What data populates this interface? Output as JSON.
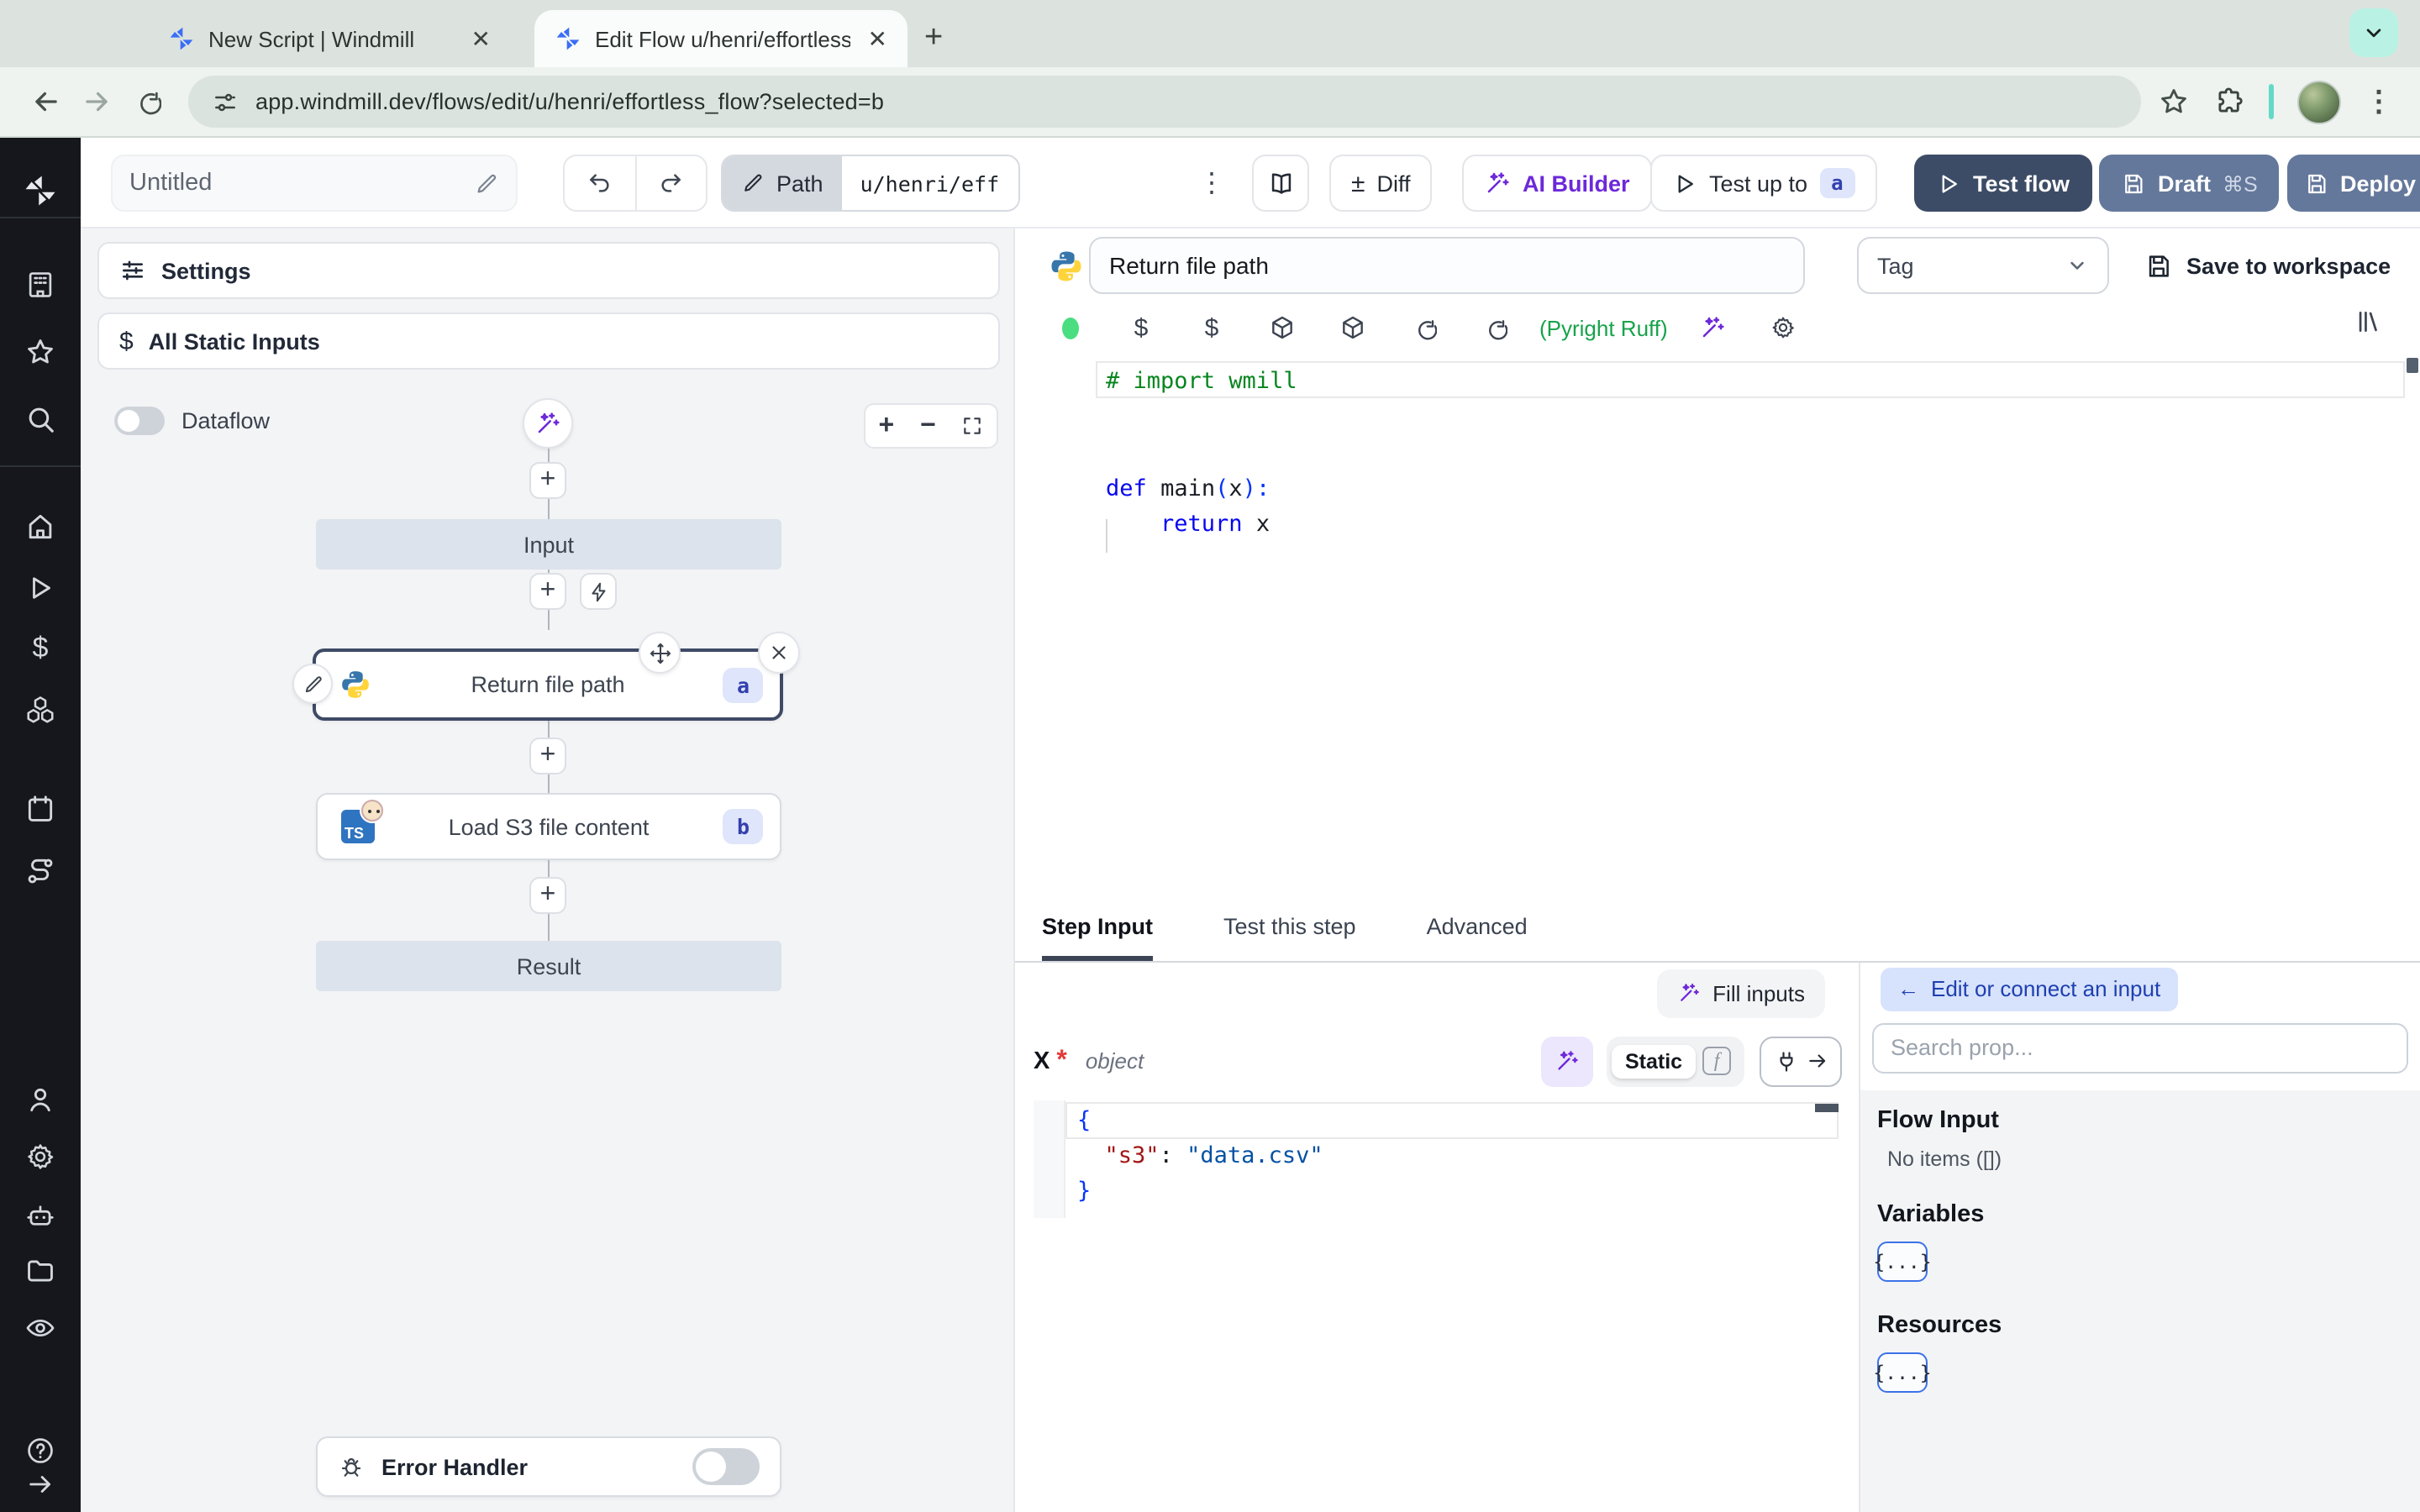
{
  "browser": {
    "tab1": "New Script | Windmill",
    "tab2": "Edit Flow u/henri/effortless_fl",
    "url": "app.windmill.dev/flows/edit/u/henri/effortless_flow?selected=b",
    "icons": [
      "windmill-favicon",
      "tab-close",
      "new-tab",
      "tab-search-chevron",
      "back",
      "forward",
      "reload",
      "site-settings",
      "bookmark-star",
      "extensions-puzzle",
      "profile-avatar",
      "browser-menu"
    ]
  },
  "sidebar": {
    "icons": [
      "windmill-logo",
      "workspace",
      "favorites",
      "search",
      "home",
      "runs",
      "variables",
      "resources",
      "schedules",
      "routes",
      "users",
      "settings",
      "workers",
      "folders",
      "audit-logs",
      "help",
      "expand"
    ]
  },
  "toolbar": {
    "untitled": "Untitled",
    "path_label": "Path",
    "path_value": "u/henri/eff",
    "diff_sign": "±",
    "diff": "Diff",
    "ai_builder": "AI Builder",
    "test_up_to": "Test up to",
    "test_up_to_badge": "a",
    "test_flow": "Test flow",
    "draft": "Draft",
    "draft_shortcut": "⌘S",
    "deploy": "Deploy"
  },
  "flow": {
    "settings": "Settings",
    "static_inputs": "All Static Inputs",
    "dataflow": "Dataflow",
    "input_label": "Input",
    "node_a": {
      "title": "Return file path",
      "badge": "a"
    },
    "node_b": {
      "title": "Load S3 file content",
      "badge": "b",
      "icon": "TS"
    },
    "result_label": "Result",
    "error_handler": "Error Handler"
  },
  "editor": {
    "step_name": "Return file path",
    "tag_placeholder": "Tag",
    "save_label": "Save to workspace",
    "lint": "(Pyright Ruff)",
    "code_lines": [
      {
        "tokens": [
          {
            "t": "# import wmill",
            "c": "comment"
          }
        ]
      },
      {
        "tokens": []
      },
      {
        "tokens": []
      },
      {
        "tokens": [
          {
            "t": "def",
            "c": "kw"
          },
          {
            "t": " ",
            "c": "plain"
          },
          {
            "t": "main",
            "c": "plain"
          },
          {
            "t": "(",
            "c": "brace"
          },
          {
            "t": "x",
            "c": "plain"
          },
          {
            "t": ")",
            "c": "brace"
          },
          {
            "t": ":",
            "c": "brace"
          }
        ]
      },
      {
        "tokens": [
          {
            "t": "    ",
            "c": "plain"
          },
          {
            "t": "return",
            "c": "kw"
          },
          {
            "t": " x",
            "c": "plain"
          }
        ]
      }
    ]
  },
  "step": {
    "tabs": {
      "step_input": "Step Input",
      "test_this_step": "Test this step",
      "advanced": "Advanced"
    },
    "fill_inputs": "Fill inputs",
    "field_name": "X",
    "field_required": "*",
    "field_type": "object",
    "static_label": "Static",
    "json_lines": [
      {
        "tokens": [
          {
            "t": "{",
            "c": "brace"
          }
        ]
      },
      {
        "tokens": [
          {
            "t": "  ",
            "c": "plain"
          },
          {
            "t": "\"s3\"",
            "c": "key"
          },
          {
            "t": ": ",
            "c": "plain"
          },
          {
            "t": "\"data.csv\"",
            "c": "str"
          }
        ]
      },
      {
        "tokens": [
          {
            "t": "}",
            "c": "brace"
          }
        ]
      }
    ]
  },
  "connect": {
    "back_arrow": "←",
    "back_label": "Edit or connect an input",
    "search_placeholder": "Search prop...",
    "flow_input": "Flow Input",
    "no_items": "No items ([])",
    "variables": "Variables",
    "resources": "Resources",
    "braces": "{...}"
  },
  "colors": {
    "accent_purple": "#6d28d9",
    "test_flow_bg": "#3d4c66",
    "draft_bg": "#64789b",
    "badge_bg": "#dfe5fb",
    "badge_text": "#3340ae",
    "lint_green": "#17a34a",
    "mint_button": "#b9f2e4",
    "sidebar_bg": "#15171c"
  }
}
